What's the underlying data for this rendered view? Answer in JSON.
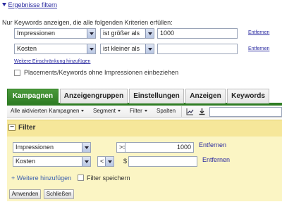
{
  "header": {
    "toggle_label": "Ergebnisse filtern"
  },
  "criteria": {
    "intro": "Nur Keywords anzeigen, die alle folgenden Kriterien erfüllen:",
    "rows": [
      {
        "metric": "Impressionen",
        "operator": "ist größer als",
        "value": "1000",
        "remove": "Entfernen"
      },
      {
        "metric": "Kosten",
        "operator": "ist kleiner als",
        "value": "",
        "remove": "Entfernen"
      }
    ],
    "add_link": "Weitere Einschränkung hinzufügen",
    "placements_checkbox": "Placements/Keywords ohne Impressionen einbeziehen"
  },
  "tabs": [
    "Kampagnen",
    "Anzeigengruppen",
    "Einstellungen",
    "Anzeigen",
    "Keywords"
  ],
  "active_tab": "Kampagnen",
  "toolbar": {
    "campaigns": "Alle aktivierten Kampagnen",
    "segment": "Segment",
    "filter": "Filter",
    "columns": "Spalten"
  },
  "filter_panel": {
    "title": "Filter",
    "collapse_symbol": "−",
    "rows": [
      {
        "metric": "Impressionen",
        "operator": ">=",
        "prefix": "",
        "value": "1000",
        "remove": "Entfernen"
      },
      {
        "metric": "Kosten",
        "operator": "<",
        "prefix": "$",
        "value": "",
        "remove": "Entfernen"
      }
    ],
    "add_more": "+ Weitere hinzufügen",
    "save_filter": "Filter speichern",
    "apply_button": "Anwenden",
    "close_button": "Schließen"
  },
  "colors": {
    "tab_active": "#2f7d24",
    "filter_bg": "#fbf5c4",
    "filter_header": "#f6e79a",
    "link": "#2a2aa0"
  }
}
